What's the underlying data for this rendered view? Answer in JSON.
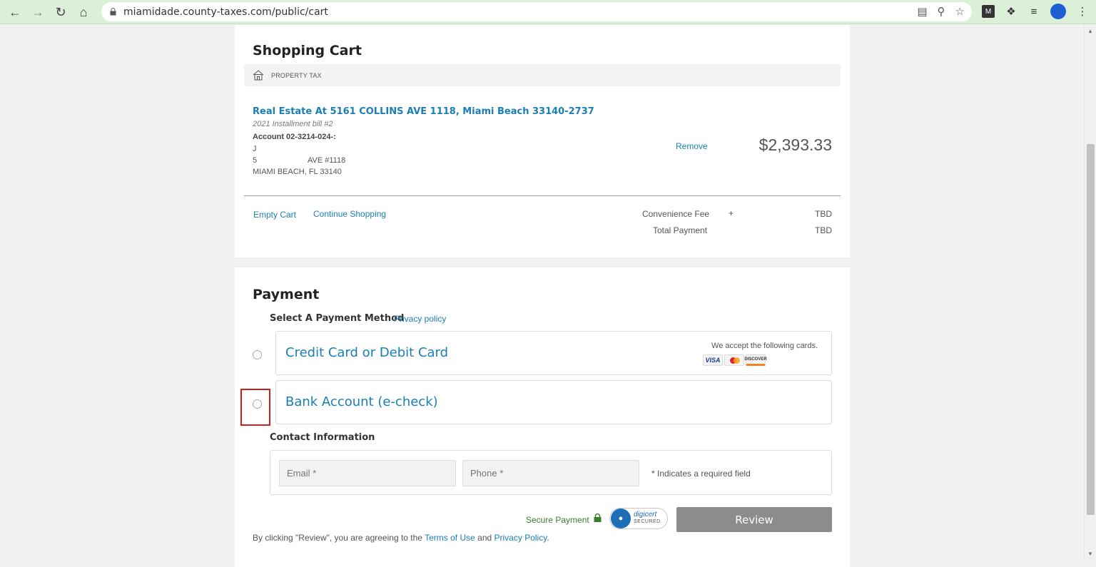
{
  "browser": {
    "url": "miamidade.county-taxes.com/public/cart",
    "avatar_color": "#1f5fd1"
  },
  "cart": {
    "title": "Shopping Cart",
    "category_label": "PROPERTY TAX",
    "item": {
      "title": "Real Estate At 5161 COLLINS AVE 1118, Miami Beach 33140-2737",
      "subtitle": "2021 Installment bill #2",
      "account": "Account 02-3214-024-:",
      "owner_line": "J",
      "street_num": "5",
      "street_rest": "AVE #1118",
      "city_line": "MIAMI BEACH, FL 33140",
      "remove_label": "Remove",
      "price": "$2,393.33"
    },
    "empty_cart_label": "Empty Cart",
    "continue_label": "Continue Shopping",
    "convenience_fee_label": "Convenience Fee",
    "convenience_plus": "+",
    "convenience_fee_value": "TBD",
    "total_label": "Total Payment",
    "total_value": "TBD"
  },
  "payment": {
    "title": "Payment",
    "select_method_label": "Select A Payment Method",
    "privacy_label": "Privacy policy",
    "methods": [
      {
        "label": "Credit Card or Debit Card",
        "note": "We accept the following cards."
      },
      {
        "label": "Bank Account (e-check)"
      }
    ],
    "card_brands": [
      "VISA",
      "MasterCard",
      "DISCOVER"
    ],
    "contact_label": "Contact Information",
    "email_placeholder": "Email *",
    "phone_placeholder": "Phone *",
    "required_note": "* Indicates a required field",
    "secure_label": "Secure Payment",
    "digicert_line1": "digicert",
    "digicert_line2": "SECURED",
    "review_label": "Review",
    "agree_prefix": "By clicking \"Review\", you are agreeing to the",
    "terms_label": "Terms of Use",
    "and_label": "and",
    "policy_label": "Privacy Policy",
    "agree_suffix": "."
  },
  "colors": {
    "link": "#1a7fb5",
    "highlight": "#d01c1c",
    "review_button": "#8c8c8c",
    "secure_green": "#3b7d2f"
  }
}
